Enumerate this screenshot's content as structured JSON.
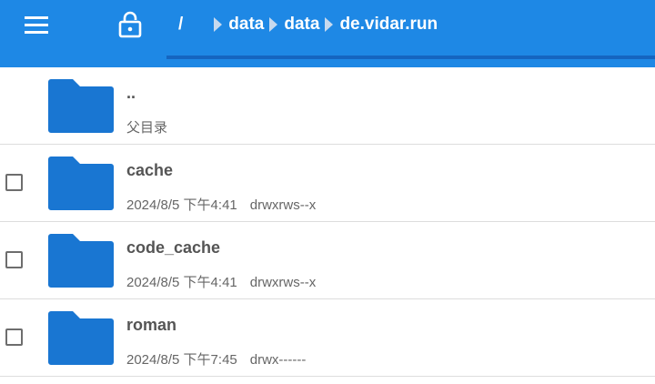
{
  "toolbar": {
    "menu_icon": "menu-icon",
    "lock_icon": "unlocked-lock-icon",
    "path": {
      "root": "/",
      "segments": [
        "data",
        "data",
        "de.vidar.run"
      ]
    },
    "accent": "#1e88e5"
  },
  "list": {
    "parent": {
      "name": "..",
      "subtitle": "父目录"
    },
    "items": [
      {
        "name": "cache",
        "date": "2024/8/5 下午4:41",
        "permissions": "drwxrws--x"
      },
      {
        "name": "code_cache",
        "date": "2024/8/5 下午4:41",
        "permissions": "drwxrws--x"
      },
      {
        "name": "roman",
        "date": "2024/8/5 下午7:45",
        "permissions": "drwx------"
      }
    ],
    "folder_color": "#1976d2"
  }
}
